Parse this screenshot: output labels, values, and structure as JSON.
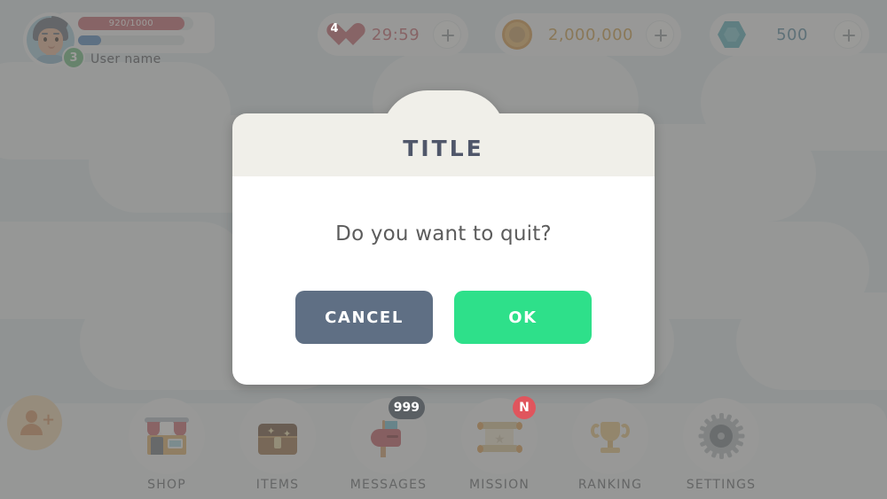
{
  "player": {
    "name": "User name",
    "level": "3",
    "hp_text": "920/1000",
    "hp_percent": 92,
    "xp_percent": 22,
    "avatar_icon": "avatar-face-icon",
    "level_badge_name": "level-badge"
  },
  "resources": [
    {
      "id": "hearts",
      "icon": "heart-icon",
      "icon_count": "4",
      "value": "29:59",
      "value_color": "#c9707a",
      "plus_label": "+"
    },
    {
      "id": "coins",
      "icon": "coin-icon",
      "value": "2,000,000",
      "value_color": "#cfa255",
      "plus_label": "+"
    },
    {
      "id": "gems",
      "icon": "gem-icon",
      "value": "500",
      "value_color": "#5f90a8",
      "plus_label": "+"
    }
  ],
  "friend_button": {
    "icon": "add-friend-icon"
  },
  "bottom_nav": [
    {
      "id": "shop",
      "label": "SHOP",
      "icon": "shop-icon",
      "badge": ""
    },
    {
      "id": "items",
      "label": "ITEMS",
      "icon": "chest-icon",
      "badge": ""
    },
    {
      "id": "messages",
      "label": "MESSAGES",
      "icon": "mailbox-icon",
      "badge": "999",
      "badge_style": "dark"
    },
    {
      "id": "mission",
      "label": "MISSION",
      "icon": "scroll-icon",
      "badge": "N",
      "badge_style": "red"
    },
    {
      "id": "ranking",
      "label": "RANKING",
      "icon": "trophy-icon",
      "badge": ""
    },
    {
      "id": "settings",
      "label": "SETTINGS",
      "icon": "gear-icon",
      "badge": ""
    }
  ],
  "dialog": {
    "title": "TITLE",
    "message": "Do you want to quit?",
    "cancel_label": "CANCEL",
    "ok_label": "OK",
    "cancel_color": "#5f6f84",
    "ok_color": "#2ee08a",
    "header_color": "#f0efe9",
    "title_color": "#50576a"
  }
}
